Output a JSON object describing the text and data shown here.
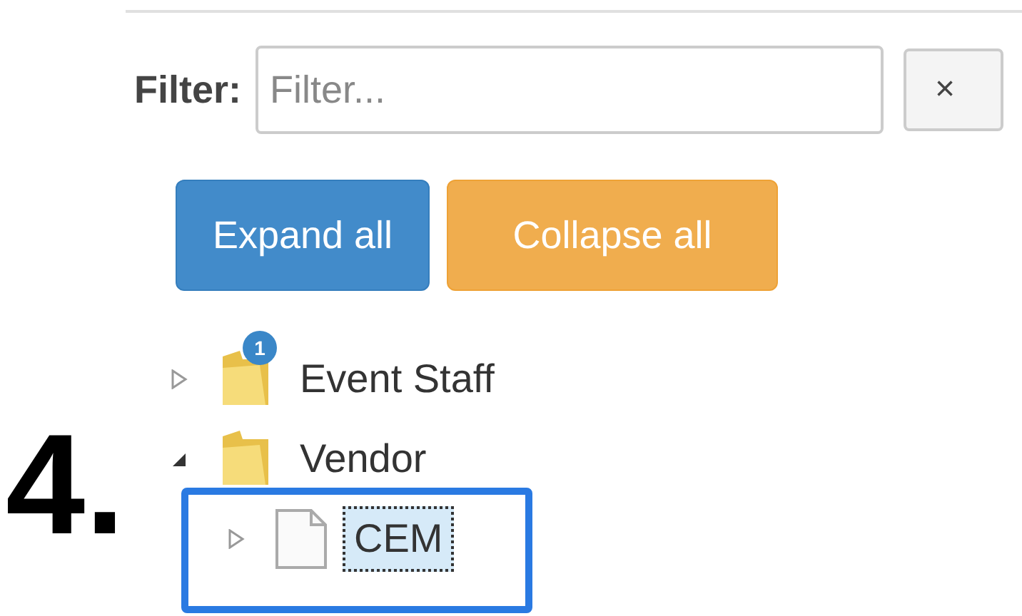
{
  "filter": {
    "label": "Filter:",
    "placeholder": "Filter...",
    "clear_button": "×"
  },
  "buttons": [
    {
      "label": "Expand all",
      "kind": "primary"
    },
    {
      "label": "Collapse all",
      "kind": "warning"
    }
  ],
  "tree": [
    {
      "label": "Event Staff",
      "kind": "folder",
      "expanded": false,
      "selected": false,
      "badge": "1"
    },
    {
      "label": "Vendor",
      "kind": "folder",
      "expanded": true,
      "selected": false,
      "children": [
        {
          "label": "CEM",
          "kind": "file",
          "expanded": false,
          "selected": true
        }
      ]
    }
  ],
  "annotation": {
    "step_label": "4."
  }
}
